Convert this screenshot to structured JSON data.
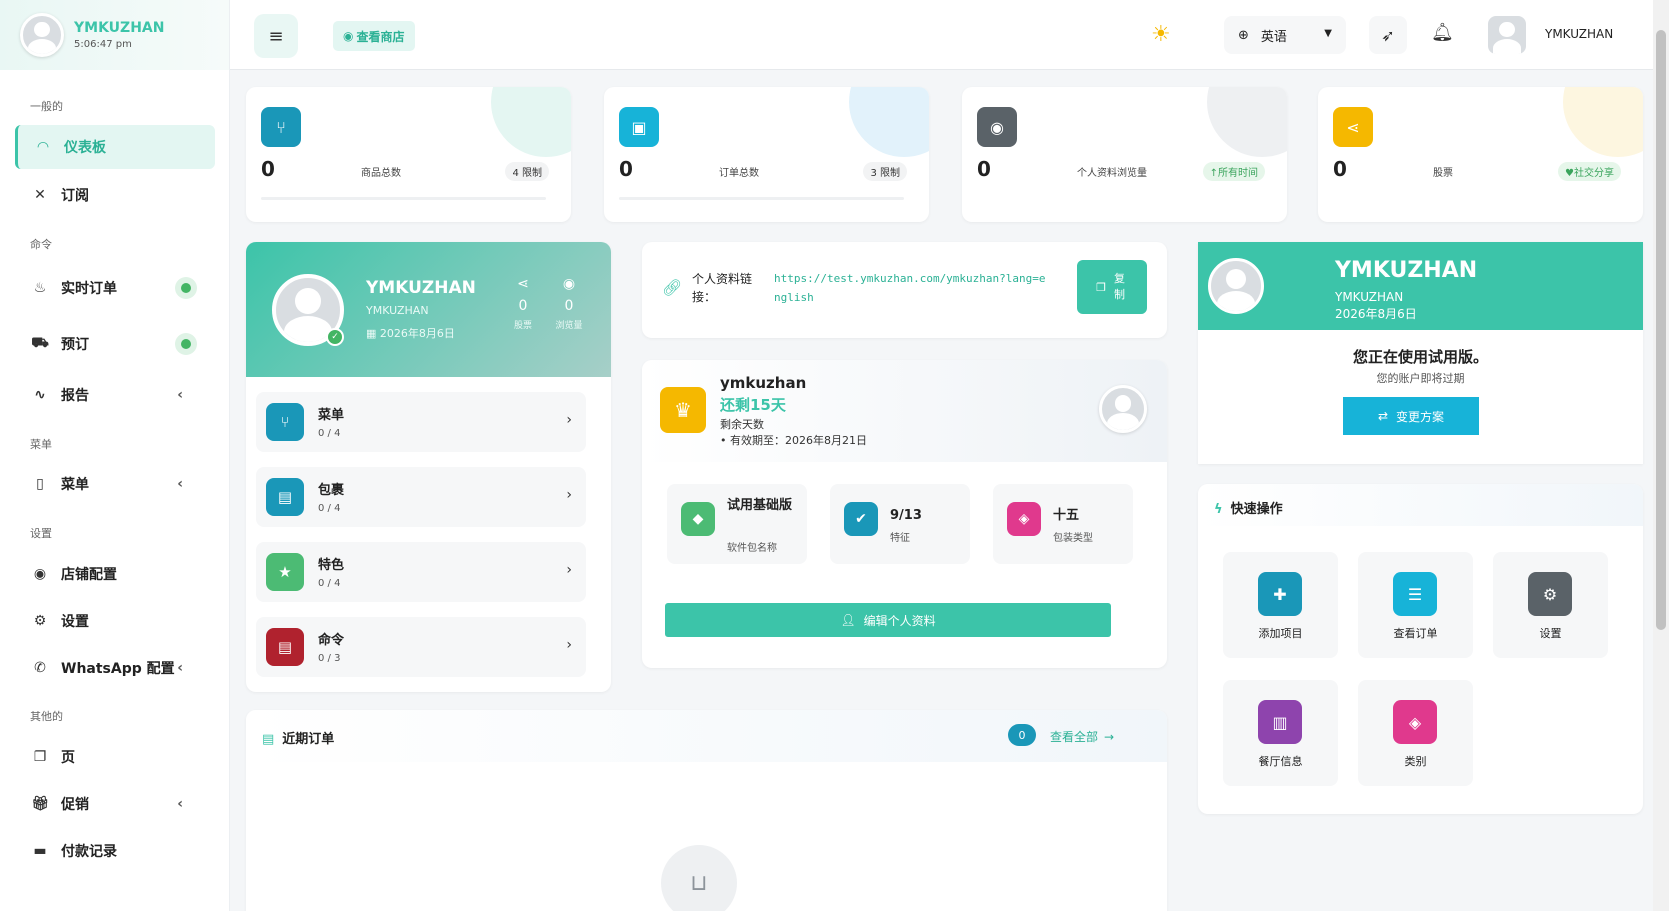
{
  "sidebar": {
    "brand_name": "YMKUZHAN",
    "brand_time": "5:06:47 pm",
    "sections": {
      "general": "一般的",
      "commands": "命令",
      "menu": "菜单",
      "settings": "设置",
      "other": "其他的"
    },
    "items": {
      "dashboard": "仪表板",
      "subscription": "订阅",
      "live_orders": "实时订单",
      "reservations": "预订",
      "reports": "报告",
      "menu": "菜单",
      "store_config": "店铺配置",
      "settings": "设置",
      "whatsapp": "WhatsApp 配置",
      "pages": "页",
      "promotions": "促销",
      "payment_records": "付款记录"
    }
  },
  "header": {
    "view_store": "查看商店",
    "language": "英语",
    "username": "YMKUZHAN"
  },
  "stats": [
    {
      "value": "0",
      "label": "商品总数",
      "badge": "4 限制"
    },
    {
      "value": "0",
      "label": "订单总数",
      "badge": "3 限制"
    },
    {
      "value": "0",
      "label": "个人资料浏览量",
      "badge": "所有时间"
    },
    {
      "value": "0",
      "label": "股票",
      "badge": "社交分享"
    }
  ],
  "profile": {
    "name": "YMKUZHAN",
    "sub": "YMKUZHAN",
    "date": "2026年8月6日",
    "shares_value": "0",
    "shares_label": "股票",
    "views_value": "0",
    "views_label": "浏览量",
    "menu_rows": [
      {
        "title": "菜单",
        "count": "0 / 4"
      },
      {
        "title": "包裹",
        "count": "0 / 4"
      },
      {
        "title": "特色",
        "count": "0 / 4"
      },
      {
        "title": "命令",
        "count": "0 / 3"
      }
    ]
  },
  "link_card": {
    "label": "个人资料链接：",
    "url": "https://test.ymkuzhan.com/ymkuzhan?lang=english",
    "copy": "复制"
  },
  "subscription": {
    "user": "ymkuzhan",
    "remaining": "还剩15天",
    "remaining_label": "剩余天数",
    "expiry": "• 有效期至：2026年8月21日",
    "features": [
      {
        "value": "试用基础版",
        "label": "软件包名称"
      },
      {
        "value": "9/13",
        "label": "特征"
      },
      {
        "value": "十五",
        "label": "包装类型"
      }
    ],
    "edit_profile": "编辑个人资料"
  },
  "trial": {
    "name": "YMKUZHAN",
    "sub": "YMKUZHAN",
    "date": "2026年8月6日",
    "title": "您正在使用试用版。",
    "warning": "您的账户即将过期",
    "change_plan": "变更方案"
  },
  "quick_actions": {
    "title": "快速操作",
    "items": [
      "添加项目",
      "查看订单",
      "设置",
      "餐厅信息",
      "类别"
    ]
  },
  "recent_orders": {
    "title": "近期订单",
    "count": "0",
    "view_all": "查看全部"
  },
  "colors": {
    "accent": "#3cc4a9",
    "blue": "#17b3d8",
    "yellow": "#f5b800",
    "green_dot": "#43b564"
  }
}
